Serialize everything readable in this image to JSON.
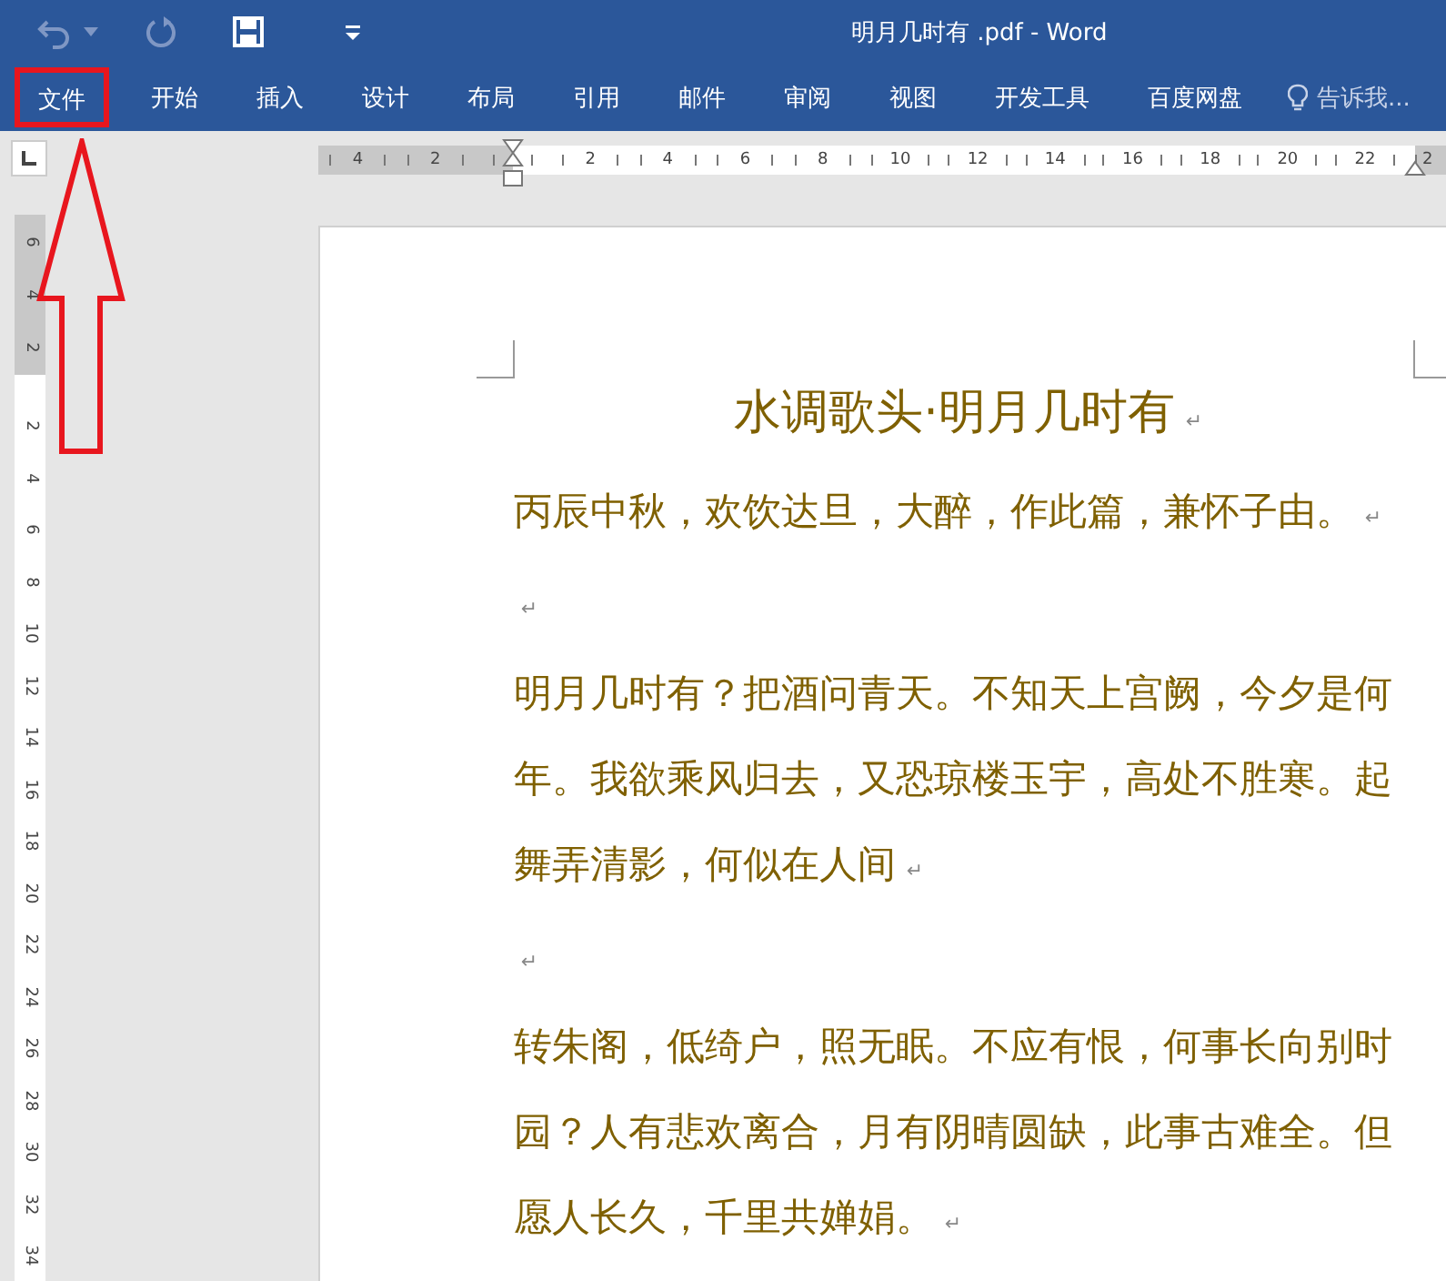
{
  "window": {
    "title": "明月几时有 .pdf - Word"
  },
  "ribbon_tabs": [
    {
      "label": "文件",
      "selected": false,
      "highlighted": true
    },
    {
      "label": "开始",
      "selected": false,
      "highlighted": false
    },
    {
      "label": "插入",
      "selected": false,
      "highlighted": false
    },
    {
      "label": "设计",
      "selected": false,
      "highlighted": false
    },
    {
      "label": "布局",
      "selected": false,
      "highlighted": false
    },
    {
      "label": "引用",
      "selected": false,
      "highlighted": false
    },
    {
      "label": "邮件",
      "selected": false,
      "highlighted": false
    },
    {
      "label": "审阅",
      "selected": false,
      "highlighted": false
    },
    {
      "label": "视图",
      "selected": false,
      "highlighted": false
    },
    {
      "label": "开发工具",
      "selected": false,
      "highlighted": false
    },
    {
      "label": "百度网盘",
      "selected": false,
      "highlighted": false
    }
  ],
  "tell_me": {
    "text": "告诉我..."
  },
  "ruler": {
    "left_margin_labels": [
      "4",
      "2"
    ],
    "labels": [
      "2",
      "4",
      "6",
      "8",
      "10",
      "12",
      "14",
      "16",
      "18",
      "20",
      "22"
    ],
    "right_margin_labels": [
      "2"
    ]
  },
  "vertical_ruler": {
    "top_margin_labels": [
      "6",
      "4",
      "2"
    ],
    "labels": [
      "2",
      "4",
      "6",
      "8",
      "10",
      "12",
      "14",
      "16",
      "18",
      "20",
      "22",
      "24",
      "26",
      "28",
      "30",
      "32",
      "34"
    ]
  },
  "document": {
    "title": "水调歌头·明月几时有",
    "title_mark": "↵",
    "paragraphs": [
      {
        "lines": [
          "丙辰中秋，欢饮达旦，大醉，作此篇，兼怀子由。"
        ],
        "mark": "↵"
      },
      {
        "mark": "↵"
      },
      {
        "lines": [
          "明月几时有？把酒问青天。不知天上宫阙，今夕是何",
          "年。我欲乘风归去，又恐琼楼玉宇，高处不胜寒。起",
          "舞弄清影，何似在人间"
        ],
        "mark": "↵"
      },
      {
        "mark": "↵"
      },
      {
        "lines": [
          "转朱阁，低绮户，照无眠。不应有恨，何事长向别时",
          "园？人有悲欢离合，月有阴晴圆缺，此事古难全。但",
          "愿人长久，千里共婵娟。"
        ],
        "mark": "↵"
      }
    ]
  }
}
